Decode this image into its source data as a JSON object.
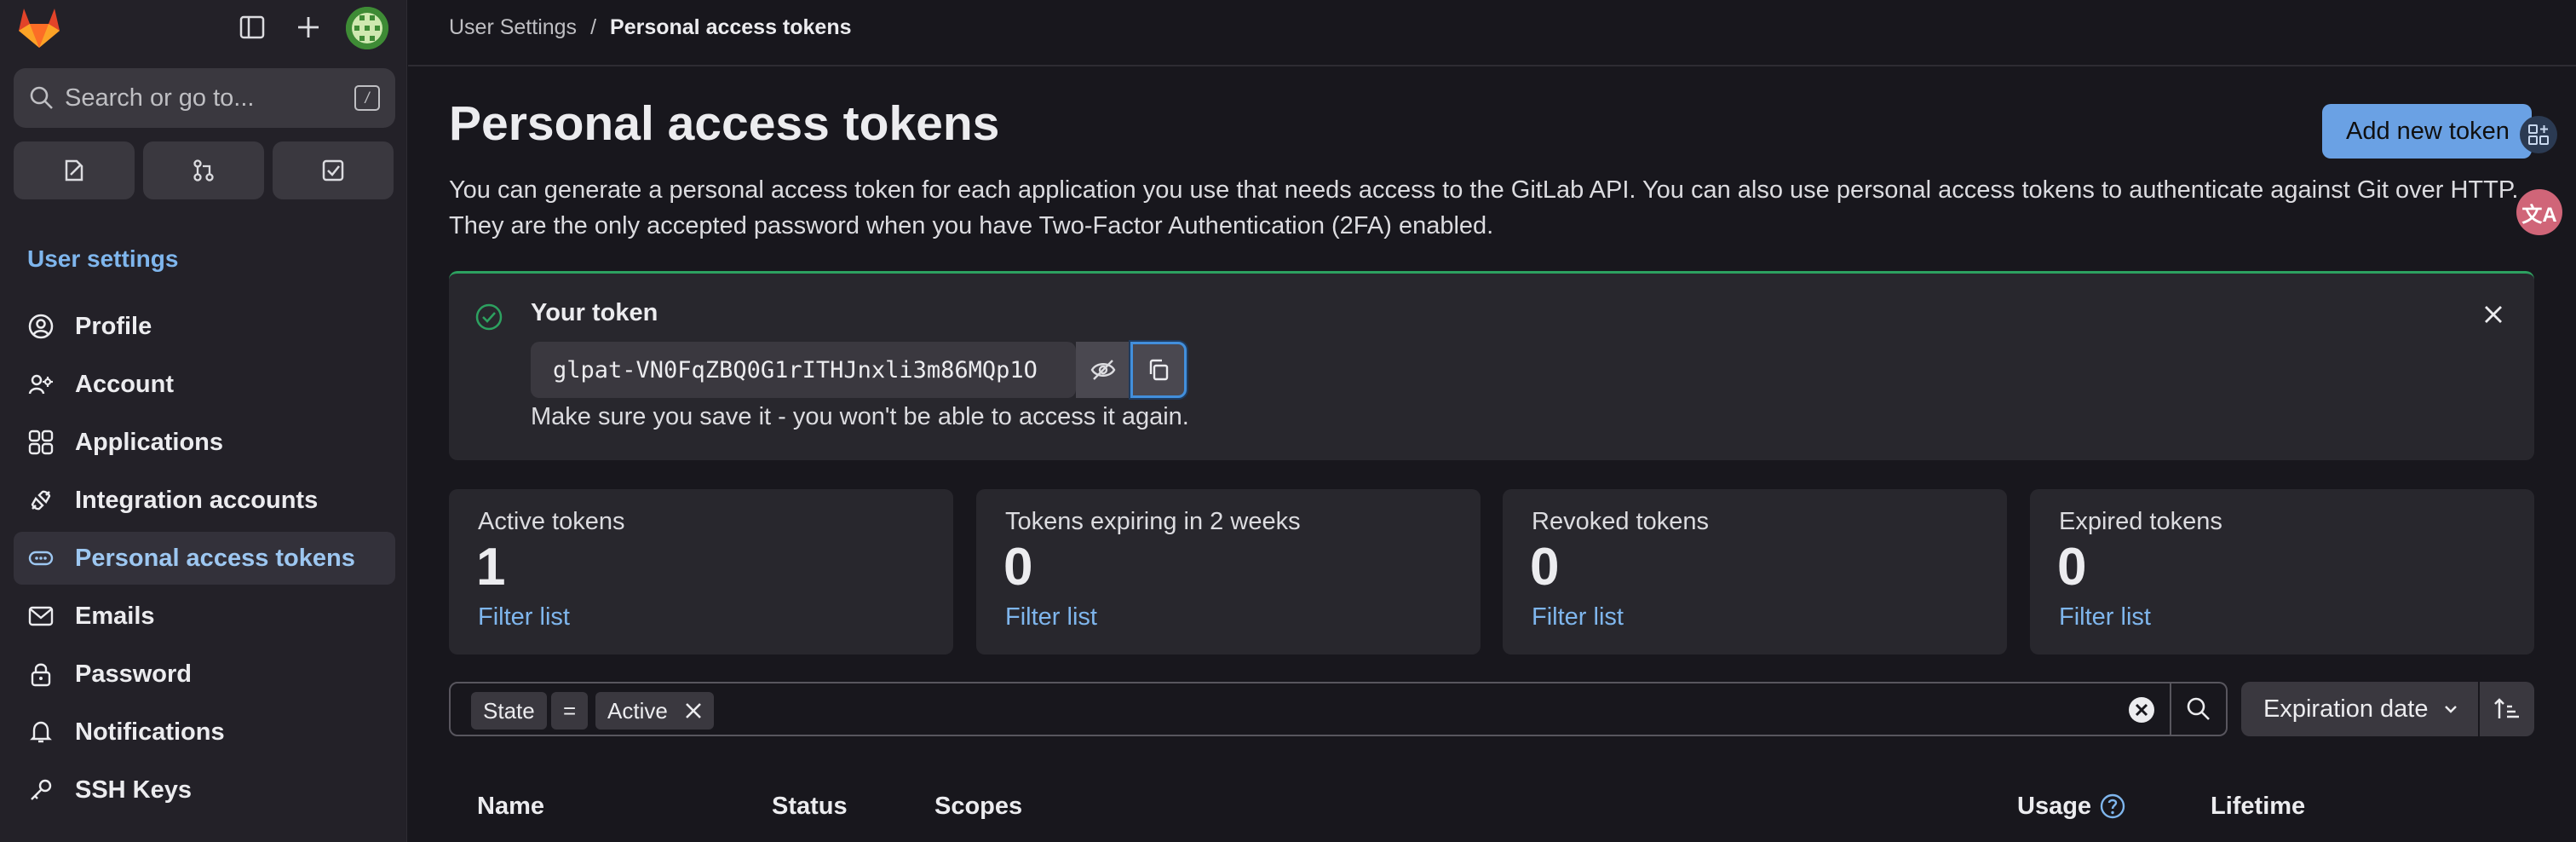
{
  "sidebar": {
    "search_placeholder": "Search or go to...",
    "search_shortcut": "/",
    "section_title": "User settings",
    "items": [
      {
        "label": "Profile",
        "icon": "profile-icon"
      },
      {
        "label": "Account",
        "icon": "account-icon"
      },
      {
        "label": "Applications",
        "icon": "applications-icon"
      },
      {
        "label": "Integration accounts",
        "icon": "integration-icon"
      },
      {
        "label": "Personal access tokens",
        "icon": "token-icon",
        "active": true
      },
      {
        "label": "Emails",
        "icon": "mail-icon"
      },
      {
        "label": "Password",
        "icon": "lock-icon"
      },
      {
        "label": "Notifications",
        "icon": "bell-icon"
      },
      {
        "label": "SSH Keys",
        "icon": "key-icon"
      }
    ]
  },
  "breadcrumb": {
    "parent": "User Settings",
    "separator": "/",
    "current": "Personal access tokens"
  },
  "page": {
    "title": "Personal access tokens",
    "add_button": "Add new token",
    "description": "You can generate a personal access token for each application you use that needs access to the GitLab API. You can also use personal access tokens to authenticate against Git over HTTP. They are the only accepted password when you have Two-Factor Authentication (2FA) enabled."
  },
  "token_alert": {
    "title": "Your token",
    "value": "glpat-VN0FqZBQ0G1rITHJnxli3m86MQp1O",
    "hint": "Make sure you save it - you won't be able to access it again."
  },
  "stats": [
    {
      "label": "Active tokens",
      "value": "1",
      "link": "Filter list"
    },
    {
      "label": "Tokens expiring in 2 weeks",
      "value": "0",
      "link": "Filter list"
    },
    {
      "label": "Revoked tokens",
      "value": "0",
      "link": "Filter list"
    },
    {
      "label": "Expired tokens",
      "value": "0",
      "link": "Filter list"
    }
  ],
  "filter": {
    "field": "State",
    "operator": "=",
    "value": "Active"
  },
  "sort": {
    "label": "Expiration date"
  },
  "table": {
    "columns": [
      "Name",
      "Status",
      "Scopes",
      "Usage",
      "Lifetime"
    ]
  },
  "floating": {
    "translate_label": "文A"
  },
  "colors": {
    "accent": "#7fb6ed",
    "primary_button": "#6aa1e4",
    "success": "#2da160"
  }
}
